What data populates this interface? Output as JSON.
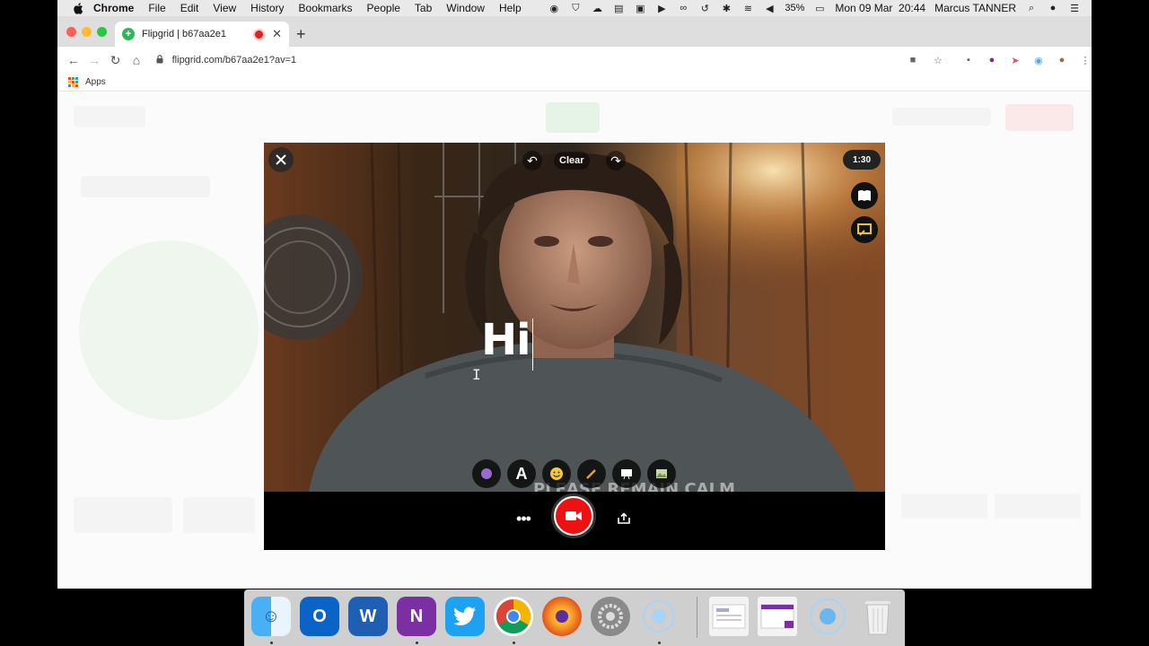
{
  "menubar": {
    "app_name": "Chrome",
    "menus": [
      "File",
      "Edit",
      "View",
      "History",
      "Bookmarks",
      "People",
      "Tab",
      "Window",
      "Help"
    ],
    "battery": "35%",
    "datetime": "Mon 09 Mar  20:44",
    "user": "Marcus TANNER"
  },
  "browser": {
    "tab_title": "Flipgrid | b67aa2e1",
    "url": "flipgrid.com/b67aa2e1?av=1",
    "bookmarks_apps": "Apps"
  },
  "recorder": {
    "clear_label": "Clear",
    "timer": "1:30",
    "overlay_text": "Hi",
    "more_label": "•••"
  },
  "colors": {
    "record_red": "#e11111",
    "flipgrid_green": "#33b55e"
  }
}
